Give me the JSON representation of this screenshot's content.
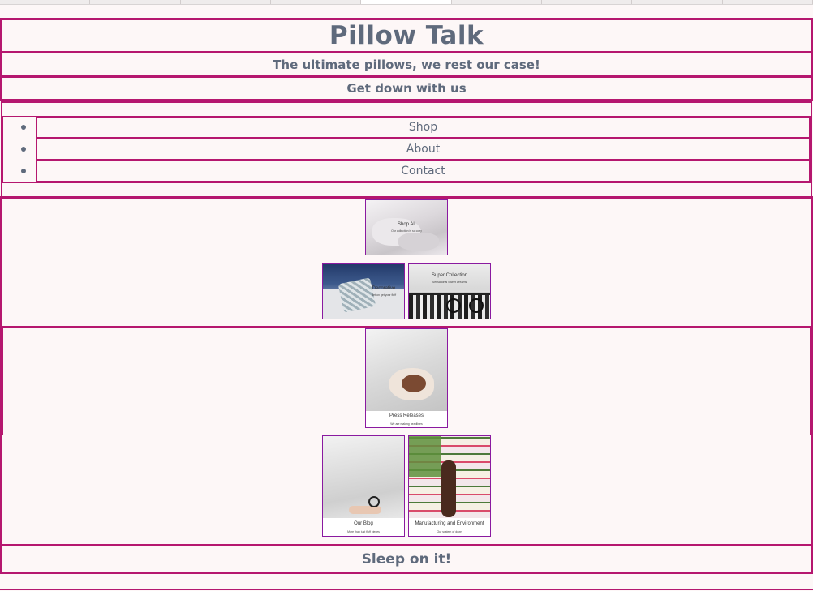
{
  "header": {
    "title": "Pillow Talk",
    "tagline": "The ultimate pillows, we rest our case!",
    "subheading": "Get down with us"
  },
  "nav": {
    "items": [
      {
        "label": "Shop"
      },
      {
        "label": "About"
      },
      {
        "label": "Contact"
      }
    ]
  },
  "tiles": {
    "shop_all": {
      "title": "Shop All",
      "subtitle": "Our collection is so cozy"
    },
    "decorative": {
      "title": "Decorative",
      "subtitle": "Bet on get your fluff"
    },
    "super_collection": {
      "title": "Super Collection",
      "subtitle": "Sensational Sweet Dreams"
    },
    "press_releases": {
      "title": "Press Releases",
      "subtitle": "We are making headlines"
    },
    "our_blog": {
      "title": "Our Blog",
      "subtitle": "More than just fluff pieces"
    },
    "manufacturing": {
      "title": "Manufacturing and Environment",
      "subtitle": "Our system of down"
    }
  },
  "footer": {
    "text": "Sleep on it!"
  },
  "colors": {
    "accent": "#b5176f",
    "tile_border": "#8a1aa0",
    "text": "#5f6a7c",
    "background": "#fdf7f7"
  }
}
